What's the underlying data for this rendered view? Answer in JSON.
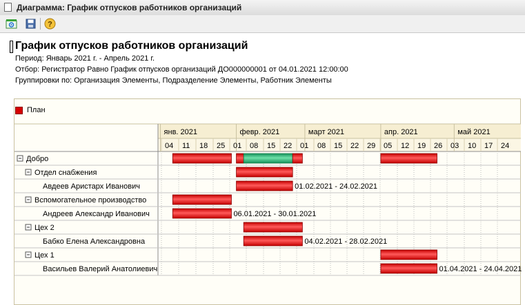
{
  "window": {
    "title": "Диаграмма: График отпусков работников организаций"
  },
  "toolbar": {
    "icons": [
      "refresh-report-icon",
      "save-icon",
      "help-icon"
    ]
  },
  "report": {
    "title": "График отпусков работников организаций",
    "period": "Период: Январь 2021 г. - Апрель 2021 г.",
    "filter": "Отбор:  Регистратор Равно График отпусков организаций ДО000000001 от 04.01.2021 12:00:00",
    "grouping": "Группировки по:  Организация Элементы, Подразделение Элементы, Работник Элементы"
  },
  "legend": {
    "items": [
      {
        "label": "План",
        "color": "#d60000"
      }
    ]
  },
  "chart_data": {
    "type": "gantt",
    "months": [
      {
        "label": "янв. 2021"
      },
      {
        "label": "февр. 2021"
      },
      {
        "label": "март 2021"
      },
      {
        "label": "апр. 2021"
      },
      {
        "label": "май 2021"
      }
    ],
    "week_labels": [
      "04",
      "11",
      "18",
      "25",
      "01",
      "08",
      "15",
      "22",
      "01",
      "08",
      "15",
      "22",
      "29",
      "05",
      "12",
      "19",
      "26",
      "03",
      "10",
      "17",
      "24"
    ],
    "rows": [
      {
        "label": "Добро",
        "level": 0,
        "expander": "⊟",
        "bars": [
          {
            "start": "2021-01-06",
            "end": "2021-01-30",
            "color": "#d60000"
          },
          {
            "start": "2021-02-01",
            "end": "2021-02-04",
            "color": "#d60000"
          },
          {
            "start": "2021-02-04",
            "end": "2021-02-24",
            "color": "#1faa6a"
          },
          {
            "start": "2021-02-24",
            "end": "2021-02-28",
            "color": "#d60000"
          },
          {
            "start": "2021-04-01",
            "end": "2021-04-24",
            "color": "#d60000"
          }
        ]
      },
      {
        "label": "Отдел снабжения",
        "level": 1,
        "expander": "⊟",
        "bars": [
          {
            "start": "2021-02-01",
            "end": "2021-02-24",
            "color": "#d60000"
          }
        ]
      },
      {
        "label": "Авдеев Аристарх Иванович",
        "level": 2,
        "expander": "",
        "bars": [
          {
            "start": "2021-02-01",
            "end": "2021-02-24",
            "color": "#d60000",
            "text": "01.02.2021 - 24.02.2021"
          }
        ]
      },
      {
        "label": "Вспомогательное производство",
        "level": 1,
        "expander": "⊟",
        "bars": [
          {
            "start": "2021-01-06",
            "end": "2021-01-30",
            "color": "#d60000"
          }
        ]
      },
      {
        "label": "Андреев Александр Иванович",
        "level": 2,
        "expander": "",
        "bars": [
          {
            "start": "2021-01-06",
            "end": "2021-01-30",
            "color": "#d60000",
            "text": "06.01.2021 - 30.01.2021"
          }
        ]
      },
      {
        "label": "Цех 2",
        "level": 1,
        "expander": "⊟",
        "bars": [
          {
            "start": "2021-02-04",
            "end": "2021-02-28",
            "color": "#d60000"
          }
        ]
      },
      {
        "label": "Бабко Елена Александровна",
        "level": 2,
        "expander": "",
        "bars": [
          {
            "start": "2021-02-04",
            "end": "2021-02-28",
            "color": "#d60000",
            "text": "04.02.2021 - 28.02.2021"
          }
        ]
      },
      {
        "label": "Цех 1",
        "level": 1,
        "expander": "⊟",
        "bars": [
          {
            "start": "2021-04-01",
            "end": "2021-04-24",
            "color": "#d60000"
          }
        ]
      },
      {
        "label": "Васильев Валерий Анатолиевич",
        "level": 2,
        "expander": "",
        "bars": [
          {
            "start": "2021-04-01",
            "end": "2021-04-24",
            "color": "#d60000",
            "text": "01.04.2021 - 24.04.2021"
          }
        ]
      }
    ]
  }
}
